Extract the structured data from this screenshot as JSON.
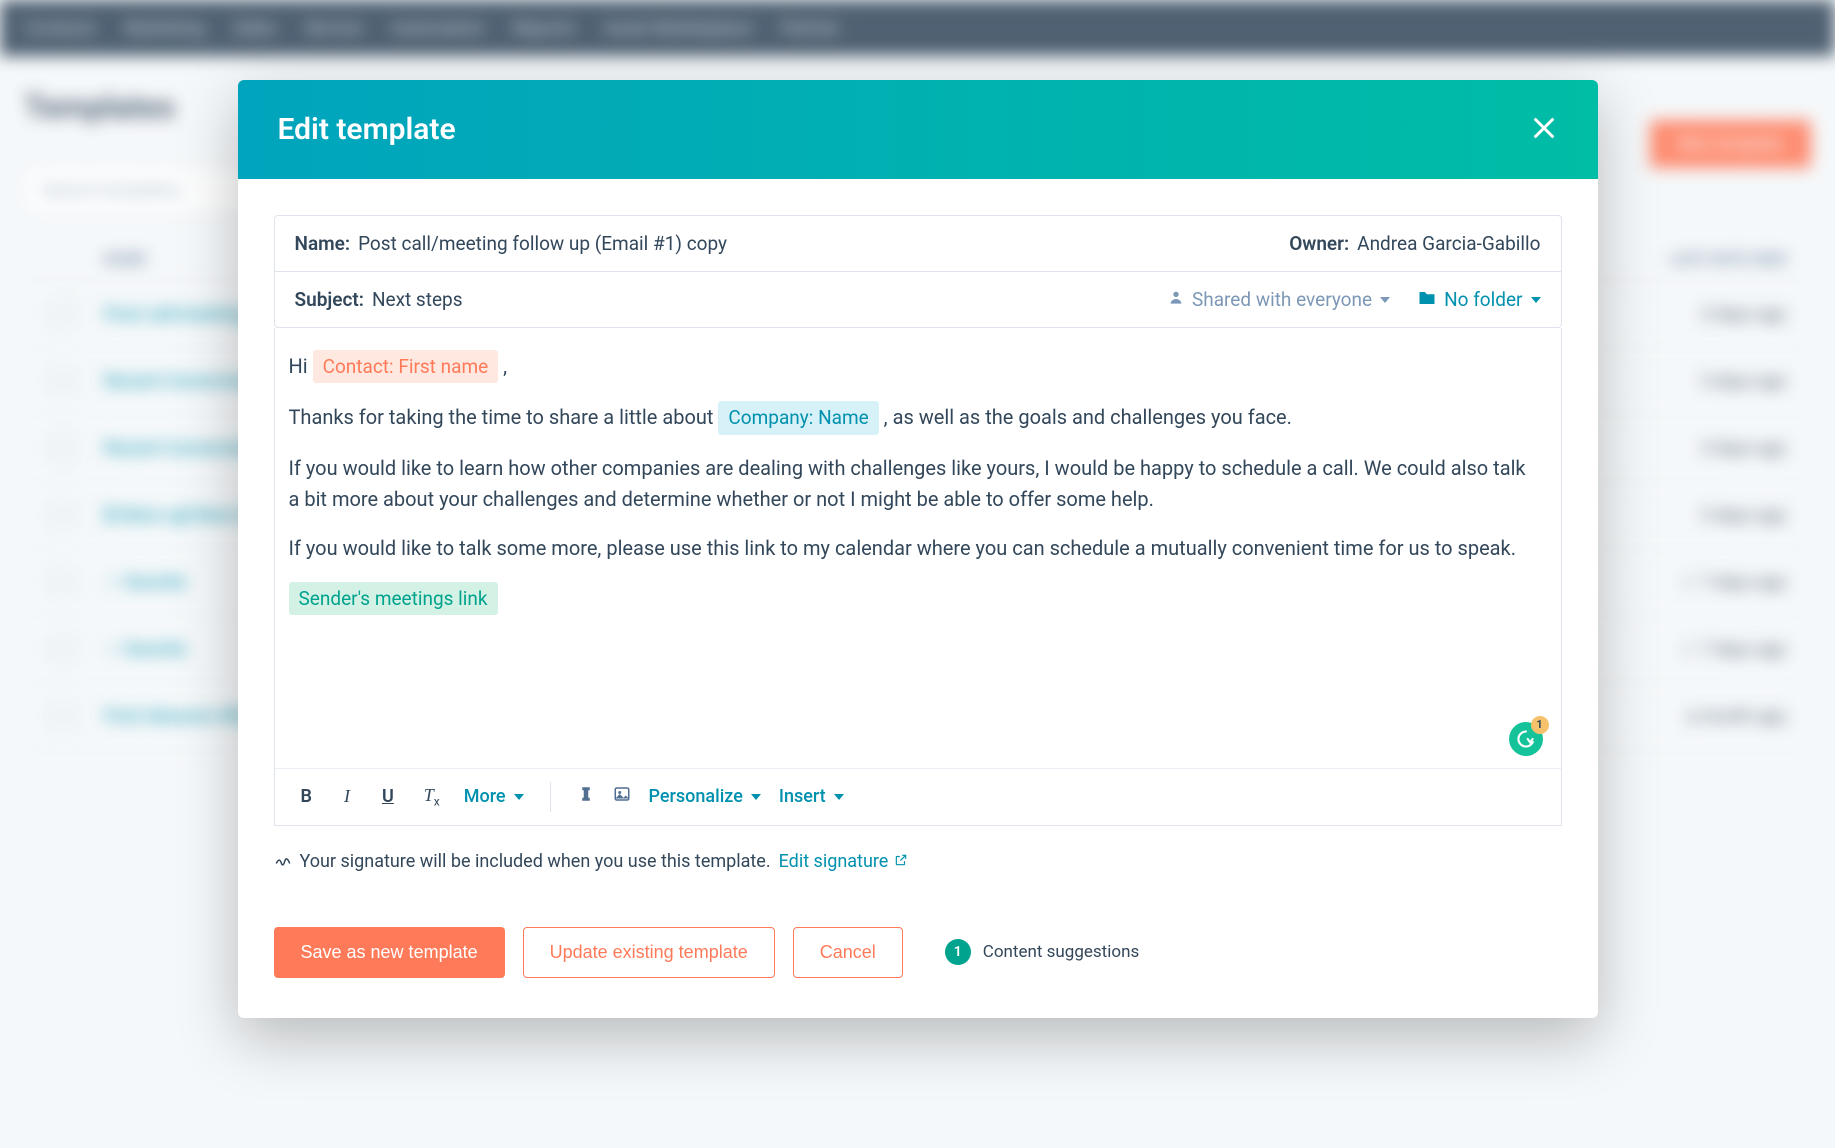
{
  "bg": {
    "nav_items": [
      "Contacts",
      "Marketing",
      "Sales",
      "Service",
      "Automation",
      "Reports",
      "Asset Marketplace",
      "Partner"
    ],
    "page_title": "Templates",
    "search_placeholder": "Search templates",
    "new_btn": "New template",
    "col_name": "NAME",
    "col_date": "LAST DATE USED",
    "rows": [
      {
        "name": "Post call/meeting follow up (Email #1)",
        "date": "3 days ago"
      },
      {
        "name": "Recent Conversion — content email",
        "date": "3 days ago"
      },
      {
        "name": "Recent Conversion — leave a voicemail",
        "date": "3 days ago"
      },
      {
        "name": "[Follow up] Next steps after meeting",
        "date": "3 days ago"
      },
      {
        "name": "☆ favorite",
        "date": "☆ 7 days ago"
      },
      {
        "name": "☆ favorite",
        "date": "☆ 7 days ago"
      },
      {
        "name": "First Inbound offer",
        "date": "a month ago"
      }
    ]
  },
  "modal": {
    "title": "Edit template",
    "name_label": "Name:",
    "name_value": "Post call/meeting follow up (Email #1) copy",
    "owner_label": "Owner:",
    "owner_value": "Andrea Garcia-Gabillo",
    "subject_label": "Subject:",
    "subject_value": "Next steps",
    "shared_label": "Shared with everyone",
    "folder_label": "No folder",
    "body": {
      "greet_pre": "Hi ",
      "token_contact": "Contact: First name",
      "greet_post": " ,",
      "p1_pre": " Thanks for taking the time to share a little about ",
      "token_company": "Company: Name",
      "p1_post": " , as well as the goals and challenges you face.",
      "p2": " If you would like to learn how other companies are dealing with challenges like yours, I would be happy to schedule a call. We could also talk a bit more about your challenges and determine whether or not I might be able to offer some help.",
      "p3": "If you would like to talk some more, please use this link to my calendar where you can schedule a mutually convenient time for us to speak.",
      "token_meeting": "Sender's meetings link"
    },
    "grammarly_count": "1",
    "toolbar": {
      "bold": "B",
      "italic": "I",
      "underline": "U",
      "clear": "Tx",
      "more": "More",
      "personalize": "Personalize",
      "insert": "Insert"
    },
    "signature_text": "Your signature will be included when you use this template.",
    "signature_link": "Edit signature",
    "footer": {
      "save_new": "Save as new template",
      "update": "Update existing template",
      "cancel": "Cancel",
      "suggestions_count": "1",
      "suggestions_label": "Content suggestions"
    }
  }
}
